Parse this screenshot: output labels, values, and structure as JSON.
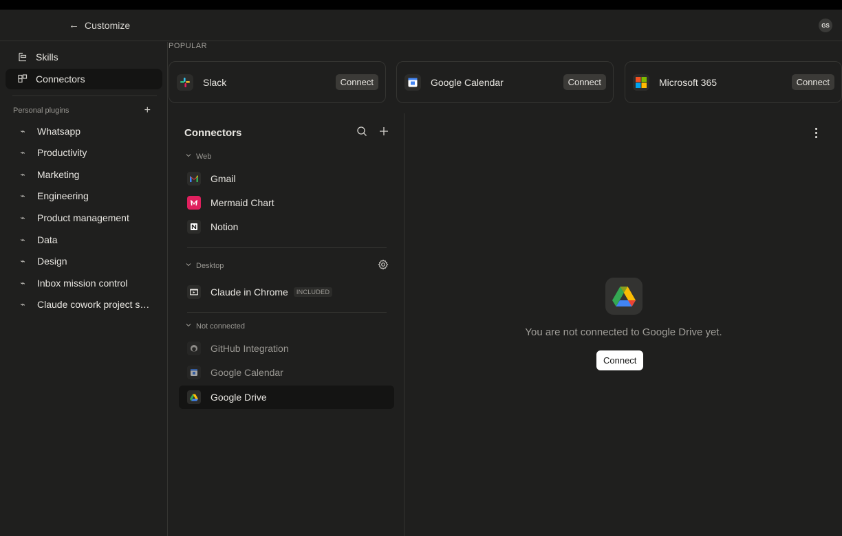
{
  "header": {
    "back_label": "Customize",
    "avatar_initials": "GS"
  },
  "sidebar": {
    "items": [
      {
        "label": "Skills",
        "icon": "skills-icon"
      },
      {
        "label": "Connectors",
        "icon": "connectors-icon",
        "active": true
      }
    ],
    "plugins_title": "Personal plugins",
    "plugins": [
      "Whatsapp",
      "Productivity",
      "Marketing",
      "Engineering",
      "Product management",
      "Data",
      "Design",
      "Inbox mission control",
      "Claude cowork project s…"
    ]
  },
  "popular": {
    "title": "POPULAR",
    "cards": [
      {
        "name": "Slack",
        "button": "Connect",
        "icon": "slack-icon"
      },
      {
        "name": "Google Calendar",
        "button": "Connect",
        "icon": "google-calendar-icon"
      },
      {
        "name": "Microsoft 365",
        "button": "Connect",
        "icon": "microsoft-365-icon"
      }
    ]
  },
  "connectors": {
    "title": "Connectors",
    "sections": {
      "web": {
        "label": "Web",
        "items": [
          "Gmail",
          "Mermaid Chart",
          "Notion"
        ]
      },
      "desktop": {
        "label": "Desktop",
        "items": [
          "Claude in Chrome"
        ],
        "badge": "INCLUDED"
      },
      "not_connected": {
        "label": "Not connected",
        "items": [
          "GitHub Integration",
          "Google Calendar",
          "Google Drive"
        ]
      }
    },
    "selected": "Google Drive"
  },
  "detail": {
    "message": "You are not connected to Google Drive yet.",
    "button": "Connect"
  },
  "colors": {
    "background": "#1f1f1e",
    "selected": "#141413",
    "border": "#343431",
    "text": "#e8e6e1",
    "muted": "#9a9893"
  }
}
